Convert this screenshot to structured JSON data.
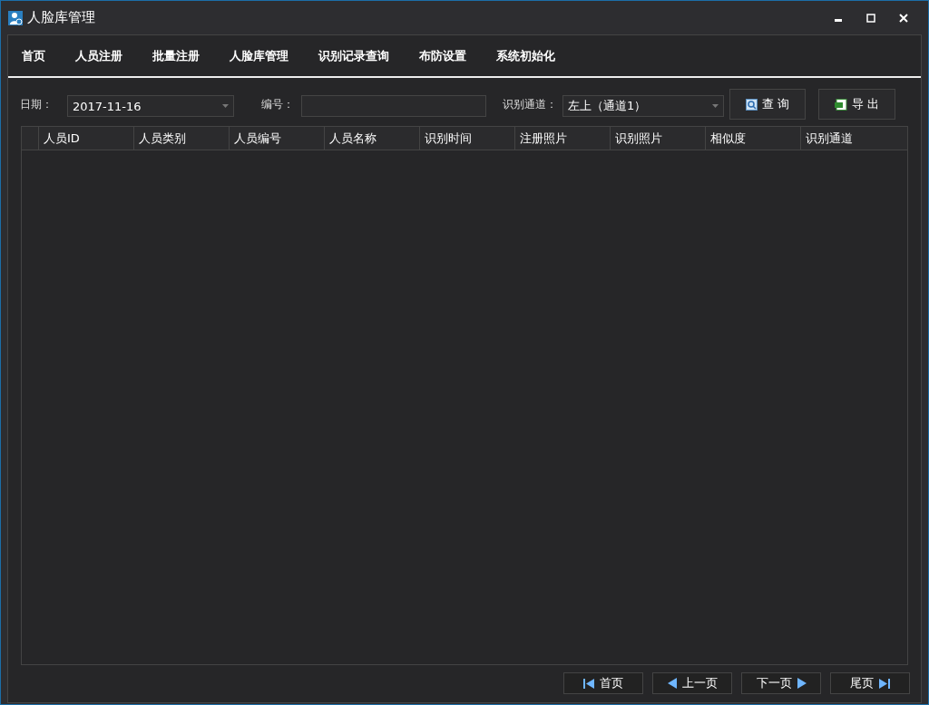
{
  "window": {
    "title": "人脸库管理"
  },
  "nav": [
    {
      "label": "首页"
    },
    {
      "label": "人员注册"
    },
    {
      "label": "批量注册"
    },
    {
      "label": "人脸库管理"
    },
    {
      "label": "识别记录查询"
    },
    {
      "label": "布防设置"
    },
    {
      "label": "系统初始化"
    }
  ],
  "filters": {
    "date_label": "日期：",
    "date_value": "2017-11-16",
    "number_label": "编号：",
    "channel_label": "识别通道：",
    "channel_value": "左上（通道1）",
    "query_button": "查 询",
    "export_button": "导 出"
  },
  "table": {
    "columns": [
      "人员ID",
      "人员类别",
      "人员编号",
      "人员名称",
      "识别时间",
      "注册照片",
      "识别照片",
      "相似度",
      "识别通道"
    ]
  },
  "pagination": [
    {
      "label": "首页",
      "kind": "first"
    },
    {
      "label": "上一页",
      "kind": "prev"
    },
    {
      "label": "下一页",
      "kind": "next"
    },
    {
      "label": "尾页",
      "kind": "last"
    }
  ]
}
